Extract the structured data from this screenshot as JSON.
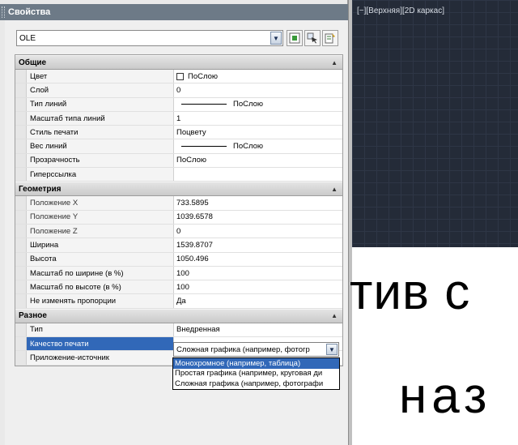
{
  "palette": {
    "title": "Свойства",
    "object_type": "OLE",
    "tools": [
      {
        "icon": "quick-select-icon"
      },
      {
        "icon": "select-objects-icon"
      },
      {
        "icon": "toggle-pickadd-icon"
      }
    ]
  },
  "categories": {
    "general": {
      "title": "Общие",
      "rows": [
        {
          "name": "Цвет",
          "value": "ПоСлою"
        },
        {
          "name": "Слой",
          "value": "0"
        },
        {
          "name": "Тип линий",
          "value": "ПоСлою"
        },
        {
          "name": "Масштаб типа линий",
          "value": "1"
        },
        {
          "name": "Стиль печати",
          "value": "Поцвету"
        },
        {
          "name": "Вес линий",
          "value": "ПоСлою"
        },
        {
          "name": "Прозрачность",
          "value": "ПоСлою"
        },
        {
          "name": "Гиперссылка",
          "value": ""
        }
      ]
    },
    "geometry": {
      "title": "Геометрия",
      "rows": [
        {
          "name": "Положение X",
          "value": "733.5895"
        },
        {
          "name": "Положение Y",
          "value": "1039.6578"
        },
        {
          "name": "Положение Z",
          "value": "0"
        },
        {
          "name": "Ширина",
          "value": "1539.8707"
        },
        {
          "name": "Высота",
          "value": "1050.496"
        },
        {
          "name": "Масштаб по ширине (в %)",
          "value": "100"
        },
        {
          "name": "Масштаб по высоте (в %)",
          "value": "100"
        },
        {
          "name": "Не изменять пропорции",
          "value": "Да"
        }
      ]
    },
    "misc": {
      "title": "Разное",
      "rows": [
        {
          "name": "Тип",
          "value": "Внедренная"
        },
        {
          "name": "Качество печати",
          "value": "Сложная графика (например, фотогр"
        },
        {
          "name": "Приложение-источник",
          "value": ""
        }
      ]
    }
  },
  "quality_dropdown": {
    "selected": "Сложная графика (например, фотогр",
    "options": [
      "Монохромное (например, таблица)",
      "Простая графика (например, круговая ди",
      "Сложная графика (например, фотографи"
    ],
    "highlighted_index": 0
  },
  "viewport": {
    "label": "[−][Верхняя][2D каркас]",
    "sheet_text_line1": "тив с",
    "sheet_text_line2": "наз"
  },
  "colors": {
    "titlebar": "#6d7a87",
    "selection": "#3168b8",
    "viewport_bg": "#242b38"
  }
}
